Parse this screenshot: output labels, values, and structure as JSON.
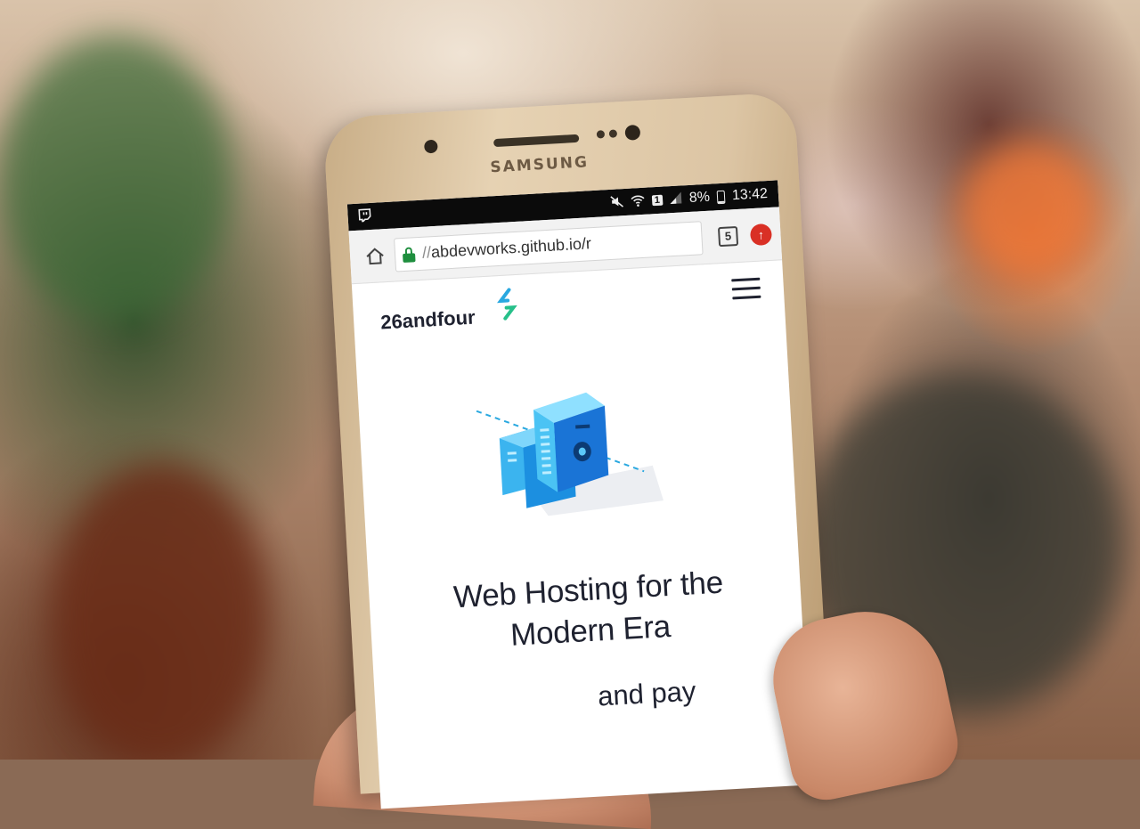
{
  "device": {
    "brand": "SAMSUNG"
  },
  "status_bar": {
    "battery_percent": "8%",
    "time": "13:42",
    "sim_slot": "1",
    "icons": [
      "twitch-icon",
      "mute-icon",
      "wifi-icon",
      "sim-icon",
      "signal-icon",
      "battery-icon"
    ]
  },
  "browser": {
    "url_scheme": "//",
    "url_host": "abdevworks.github.io/r",
    "tab_count": "5",
    "icons": [
      "home-icon",
      "lock-icon",
      "tabs-icon",
      "update-icon"
    ]
  },
  "site": {
    "logo_text": "26andfour",
    "hero_title": "Web Hosting for the Modern Era",
    "hero_subtitle_partial": "and pay",
    "colors": {
      "accent_blue": "#29a8e0",
      "accent_green": "#27c08a",
      "text_dark": "#1f2230"
    }
  }
}
